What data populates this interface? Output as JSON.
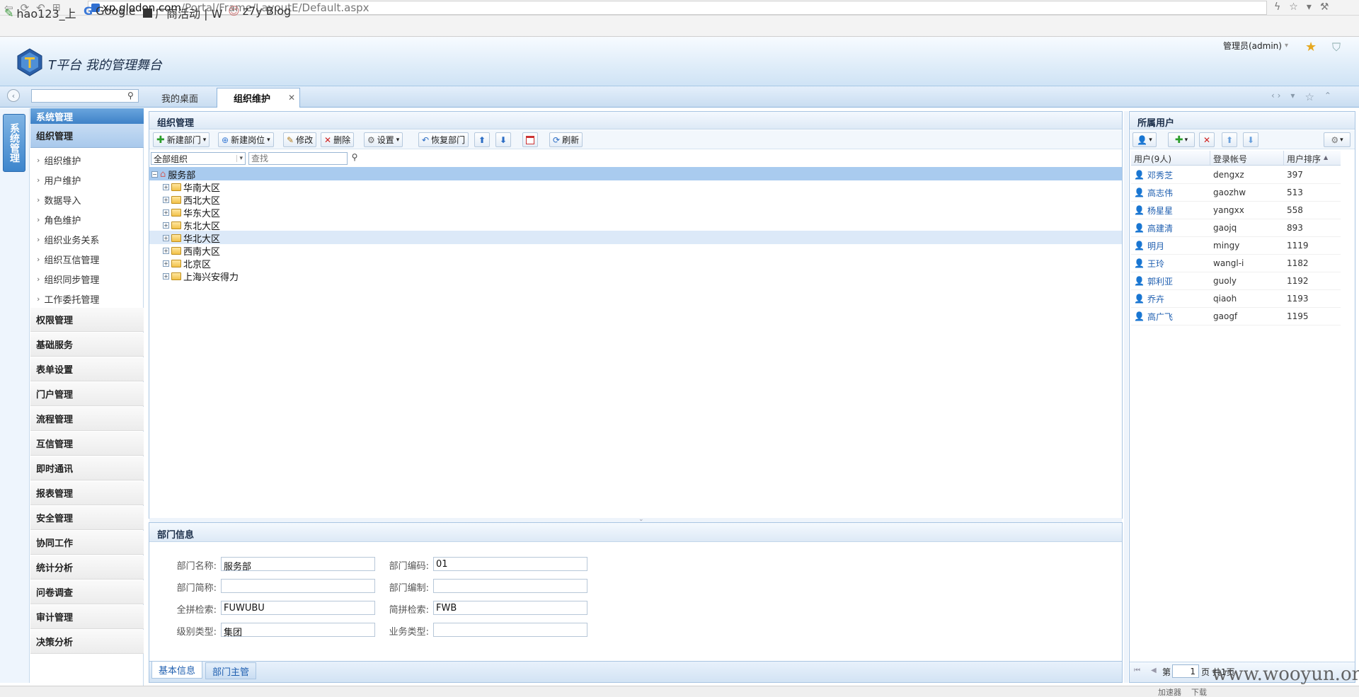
{
  "browser": {
    "url_domain": "xp.glodon.com",
    "url_path": "/Portal/Frame/LayoutE/Default.aspx",
    "bookmarks": [
      {
        "label": "hao123_上"
      },
      {
        "label": "Google"
      },
      {
        "label": "厂商活动 | W"
      },
      {
        "label": "z7y Blog"
      }
    ],
    "status_items": [
      "加速器",
      "下载"
    ]
  },
  "header": {
    "app_title": "T平台  我的管理舞台",
    "user": "管理员(admin)"
  },
  "tabs": [
    {
      "label": "我的桌面",
      "active": false
    },
    {
      "label": "组织维护",
      "active": true
    }
  ],
  "rail": {
    "label": "系统管理"
  },
  "sidebar": {
    "header": "系统管理",
    "active_section": "组织管理",
    "sub_items": [
      "组织维护",
      "用户维护",
      "数据导入",
      "角色维护",
      "组织业务关系",
      "组织互信管理",
      "组织同步管理",
      "工作委托管理"
    ],
    "sections": [
      "权限管理",
      "基础服务",
      "表单设置",
      "门户管理",
      "流程管理",
      "互信管理",
      "即时通讯",
      "报表管理",
      "安全管理",
      "协同工作",
      "统计分析",
      "问卷调查",
      "审计管理",
      "决策分析"
    ]
  },
  "org_panel": {
    "title": "组织管理",
    "toolbar": {
      "new_dept": "新建部门",
      "new_post": "新建岗位",
      "edit": "修改",
      "delete": "删除",
      "settings": "设置",
      "restore_dept": "恢复部门",
      "refresh": "刷新"
    },
    "filter_select": "全部组织",
    "search_placeholder": "查找",
    "tree_root": "服务部",
    "tree_children": [
      "华南大区",
      "西北大区",
      "华东大区",
      "东北大区",
      "华北大区",
      "西南大区",
      "北京区",
      "上海兴安得力"
    ],
    "selected_child": "华北大区"
  },
  "dept_info": {
    "title": "部门信息",
    "fields": {
      "name_label": "部门名称:",
      "name_value": "服务部",
      "code_label": "部门编码:",
      "code_value": "01",
      "short_label": "部门简称:",
      "short_value": "",
      "staff_label": "部门编制:",
      "staff_value": "",
      "pinyin_label": "全拼检索:",
      "pinyin_value": "FUWUBU",
      "abbr_label": "简拼检索:",
      "abbr_value": "FWB",
      "level_label": "级别类型:",
      "level_value": "集团",
      "biz_label": "业务类型:",
      "biz_value": ""
    },
    "bottom_tabs": [
      "基本信息",
      "部门主管"
    ]
  },
  "users_panel": {
    "title": "所属用户",
    "columns": [
      "用户(9人)",
      "登录帐号",
      "用户排序"
    ],
    "rows": [
      {
        "name": "邓秀芝",
        "account": "dengxz",
        "order": "397",
        "gender": "m"
      },
      {
        "name": "高志伟",
        "account": "gaozhw",
        "order": "513",
        "gender": "m"
      },
      {
        "name": "杨星星",
        "account": "yangxx",
        "order": "558",
        "gender": "m"
      },
      {
        "name": "高建清",
        "account": "gaojq",
        "order": "893",
        "gender": "m"
      },
      {
        "name": "明月",
        "account": "mingy",
        "order": "1119",
        "gender": "f"
      },
      {
        "name": "王玲",
        "account": "wangl-i",
        "order": "1182",
        "gender": "f"
      },
      {
        "name": "郭利亚",
        "account": "guoly",
        "order": "1192",
        "gender": "f"
      },
      {
        "name": "乔卉",
        "account": "qiaoh",
        "order": "1193",
        "gender": "f"
      },
      {
        "name": "高广飞",
        "account": "gaogf",
        "order": "1195",
        "gender": "f"
      }
    ],
    "pager": {
      "prefix": "第",
      "page": "1",
      "suffix": "页 共1页"
    }
  },
  "watermark": "www.wooyun.org",
  "colors": {
    "accent": "#3e82c8",
    "selection": "#dce9f8",
    "link": "#1f5fb0"
  }
}
